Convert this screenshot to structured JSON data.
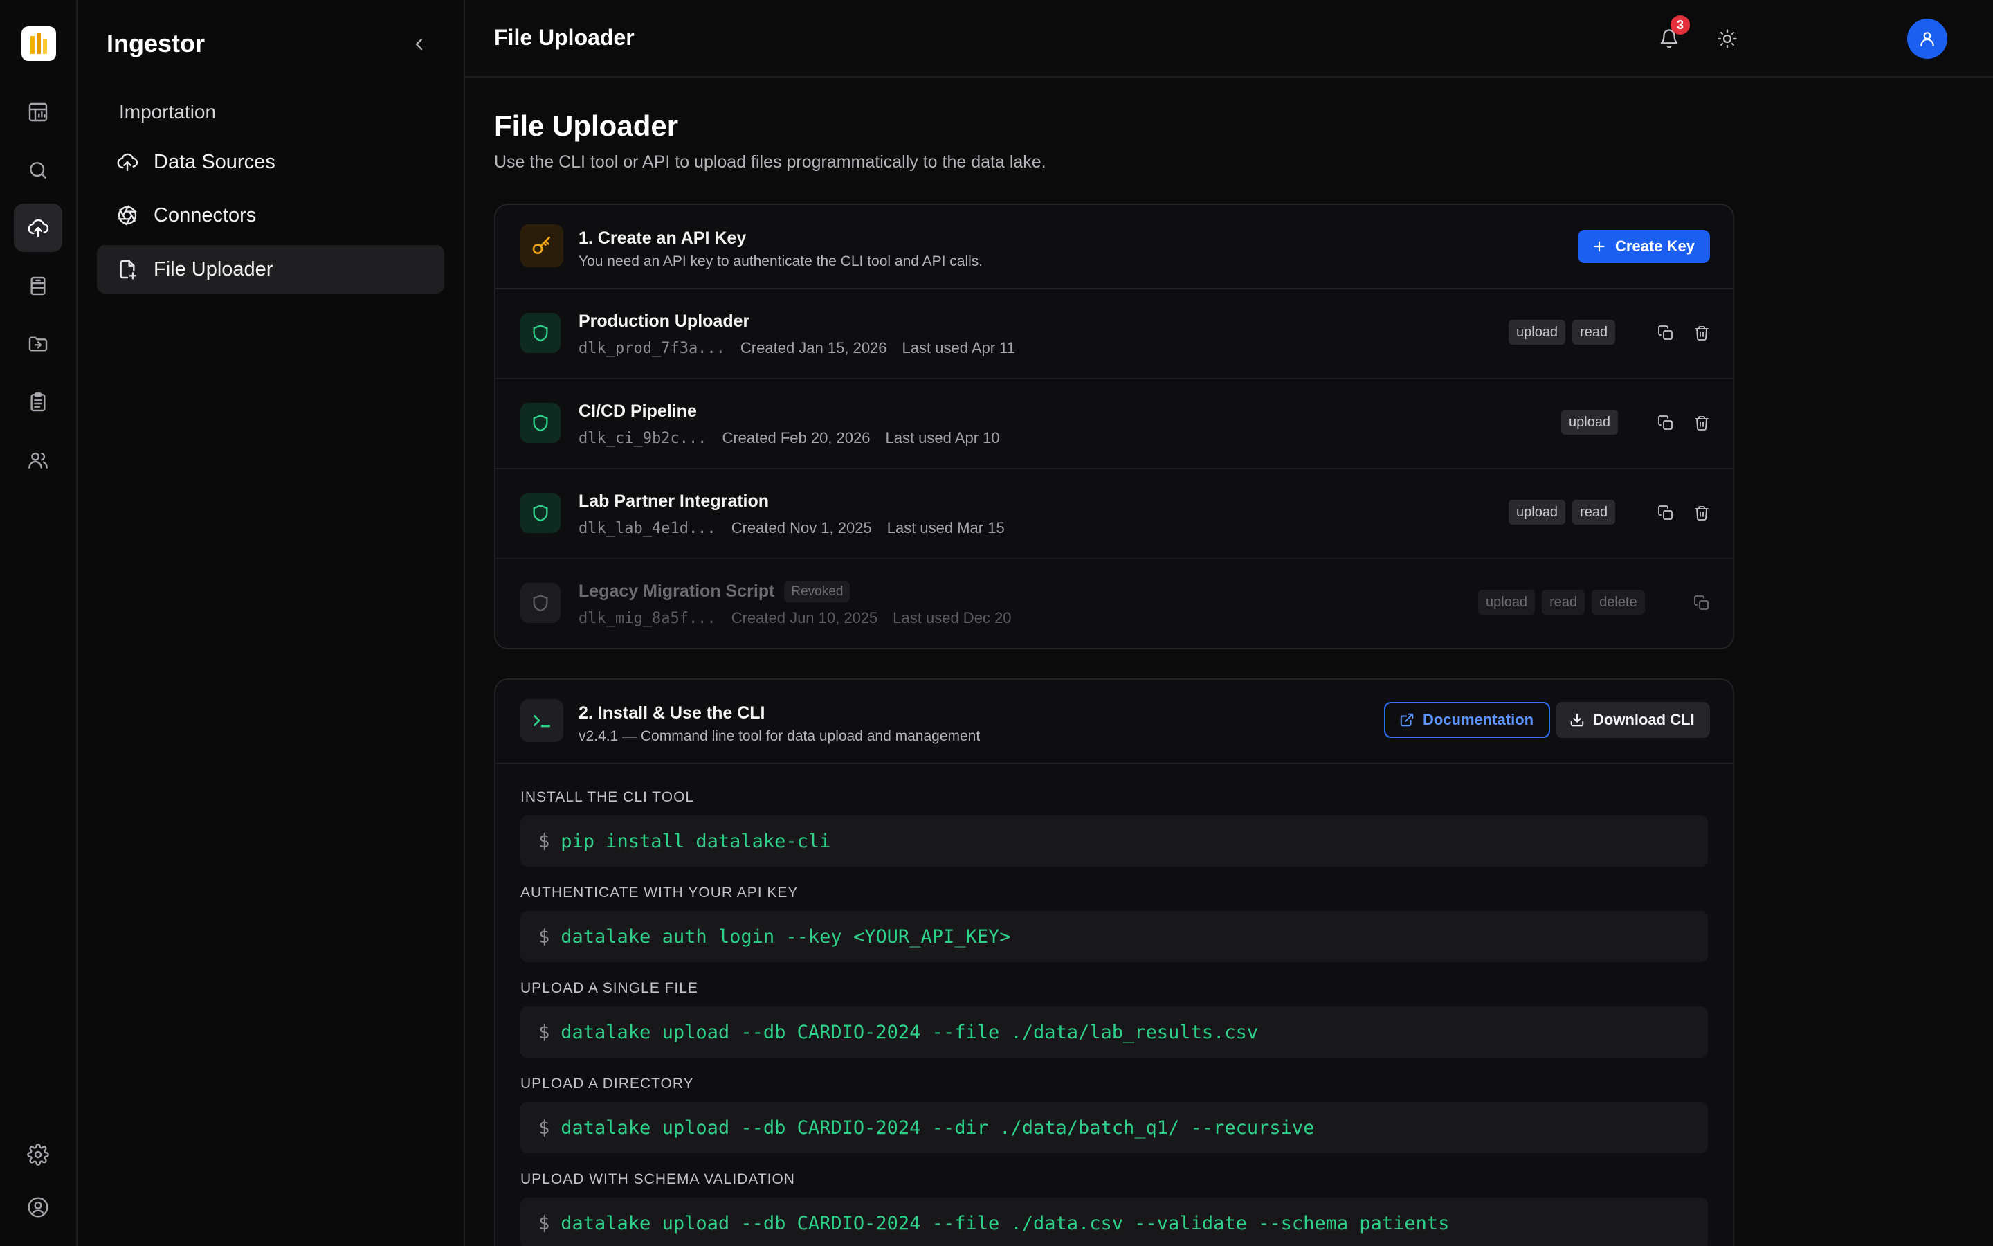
{
  "app": {
    "brand": "Ingestor",
    "section_label": "Importation",
    "nav": [
      {
        "label": "Data Sources",
        "icon": "cloud-upload-icon"
      },
      {
        "label": "Connectors",
        "icon": "aperture-icon"
      },
      {
        "label": "File Uploader",
        "icon": "file-plus-icon"
      }
    ]
  },
  "topbar": {
    "title": "File Uploader",
    "notification_count": "3"
  },
  "page": {
    "title": "File Uploader",
    "subtitle": "Use the CLI tool or API to upload files programmatically to the data lake."
  },
  "api_keys": {
    "title": "1. Create an API Key",
    "description": "You need an API key to authenticate the CLI tool and API calls.",
    "create_label": "Create Key",
    "revoked_label": "Revoked",
    "keys": [
      {
        "name": "Production Uploader",
        "key": "dlk_prod_7f3a...",
        "created": "Created Jan 15, 2026",
        "last_used": "Last used Apr 11",
        "tags": [
          "upload",
          "read"
        ],
        "revoked": false
      },
      {
        "name": "CI/CD Pipeline",
        "key": "dlk_ci_9b2c...",
        "created": "Created Feb 20, 2026",
        "last_used": "Last used Apr 10",
        "tags": [
          "upload"
        ],
        "revoked": false
      },
      {
        "name": "Lab Partner Integration",
        "key": "dlk_lab_4e1d...",
        "created": "Created Nov 1, 2025",
        "last_used": "Last used Mar 15",
        "tags": [
          "upload",
          "read"
        ],
        "revoked": false
      },
      {
        "name": "Legacy Migration Script",
        "key": "dlk_mig_8a5f...",
        "created": "Created Jun 10, 2025",
        "last_used": "Last used Dec 20",
        "tags": [
          "upload",
          "read",
          "delete"
        ],
        "revoked": true
      }
    ]
  },
  "cli": {
    "title": "2. Install & Use the CLI",
    "description": "v2.4.1 — Command line tool for data upload and management",
    "docs_label": "Documentation",
    "download_label": "Download CLI",
    "prompt": "$",
    "steps": [
      {
        "label": "INSTALL THE CLI TOOL",
        "command": "pip install datalake-cli"
      },
      {
        "label": "AUTHENTICATE WITH YOUR API KEY",
        "command": "datalake auth login --key <YOUR_API_KEY>"
      },
      {
        "label": "UPLOAD A SINGLE FILE",
        "command": "datalake upload --db CARDIO-2024 --file ./data/lab_results.csv"
      },
      {
        "label": "UPLOAD A DIRECTORY",
        "command": "datalake upload --db CARDIO-2024 --dir ./data/batch_q1/ --recursive"
      },
      {
        "label": "UPLOAD WITH SCHEMA VALIDATION",
        "command": "datalake upload --db CARDIO-2024 --file ./data.csv --validate --schema patients"
      }
    ]
  },
  "colors": {
    "accent": "#1a5ff0",
    "success": "#2fd18a",
    "key_icon": "#f2a51a",
    "notification": "#e5303c"
  }
}
